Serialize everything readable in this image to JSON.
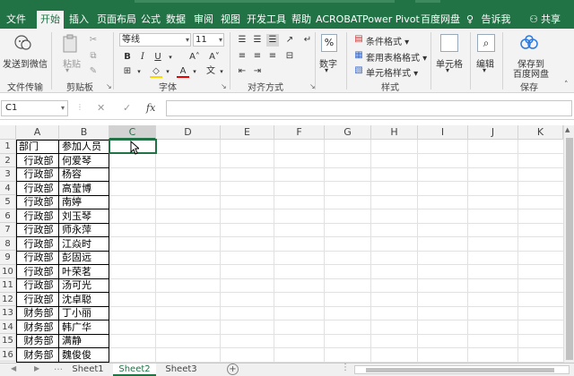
{
  "ribbon_tabs": [
    {
      "label": "文件",
      "active": false
    },
    {
      "label": "开始",
      "active": true
    },
    {
      "label": "插入",
      "active": false
    },
    {
      "label": "页面布局",
      "active": false
    },
    {
      "label": "公式",
      "active": false
    },
    {
      "label": "数据",
      "active": false
    },
    {
      "label": "审阅",
      "active": false
    },
    {
      "label": "视图",
      "active": false
    },
    {
      "label": "开发工具",
      "active": false
    },
    {
      "label": "帮助",
      "active": false
    },
    {
      "label": "ACROBAT",
      "active": false
    },
    {
      "label": "Power Pivot",
      "active": false
    },
    {
      "label": "百度网盘",
      "active": false
    },
    {
      "label": "告诉我",
      "active": false
    },
    {
      "label": "共享",
      "active": false
    }
  ],
  "ribbon": {
    "send_wechat": "发送到微信",
    "paste": "粘贴",
    "font_name": "等线",
    "font_size": "11",
    "bold": "B",
    "italic": "I",
    "underline": "U",
    "font_color_letter": "A",
    "number_format": "%",
    "number": "数字",
    "cond_format": "条件格式",
    "table_format": "套用表格格式",
    "cell_style": "单元格样式",
    "cells": "单元格",
    "edit": "编辑",
    "save_baidu_line1": "保存到",
    "save_baidu_line2": "百度网盘",
    "groups": {
      "file_transfer": "文件传输",
      "clipboard": "剪贴板",
      "font": "字体",
      "alignment": "对齐方式",
      "styles": "样式",
      "save": "保存"
    }
  },
  "formula_bar": {
    "name_box": "C1",
    "fx_label": "fx",
    "cancel": "✕",
    "confirm": "✓",
    "formula": ""
  },
  "columns": [
    "A",
    "B",
    "C",
    "D",
    "E",
    "F",
    "G",
    "H",
    "I",
    "J",
    "K"
  ],
  "selected_cell": "C1",
  "rows": [
    {
      "n": "1",
      "a": "部门",
      "b": "参加人员"
    },
    {
      "n": "2",
      "a": "行政部",
      "b": "何爱琴"
    },
    {
      "n": "3",
      "a": "行政部",
      "b": "杨容"
    },
    {
      "n": "4",
      "a": "行政部",
      "b": "高莹博"
    },
    {
      "n": "5",
      "a": "行政部",
      "b": "南婷"
    },
    {
      "n": "6",
      "a": "行政部",
      "b": "刘玉琴"
    },
    {
      "n": "7",
      "a": "行政部",
      "b": "师永萍"
    },
    {
      "n": "8",
      "a": "行政部",
      "b": "江焱时"
    },
    {
      "n": "9",
      "a": "行政部",
      "b": "彭固远"
    },
    {
      "n": "10",
      "a": "行政部",
      "b": "叶荣茗"
    },
    {
      "n": "11",
      "a": "行政部",
      "b": "汤可光"
    },
    {
      "n": "12",
      "a": "行政部",
      "b": "沈卓聪"
    },
    {
      "n": "13",
      "a": "财务部",
      "b": "丁小丽"
    },
    {
      "n": "14",
      "a": "财务部",
      "b": "韩广华"
    },
    {
      "n": "15",
      "a": "财务部",
      "b": "满静"
    },
    {
      "n": "16",
      "a": "财务部",
      "b": "魏俊俊"
    }
  ],
  "sheets": [
    {
      "label": "Sheet1",
      "active": false
    },
    {
      "label": "Sheet2",
      "active": true
    },
    {
      "label": "Sheet3",
      "active": false
    }
  ],
  "colors": {
    "accent": "#217346"
  }
}
